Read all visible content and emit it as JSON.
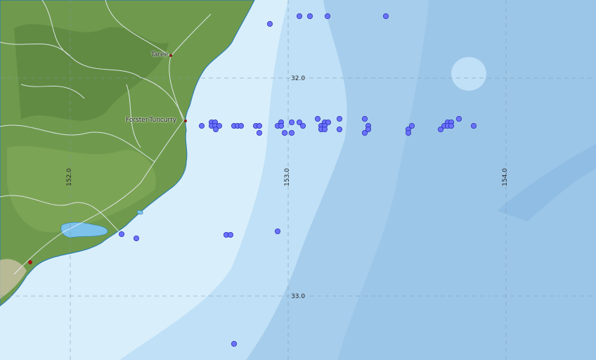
{
  "map": {
    "colors": {
      "shallow": "#d9eefb",
      "mid": "#bfe0f6",
      "deep": "#a6cdec",
      "deeper": "#8fbde3",
      "land": "#6f9a4d",
      "land_dark": "#56803a",
      "coast": "#2f7fb0",
      "road": "#e8e8ff",
      "point_fill": "#6b72ff",
      "point_stroke": "#2a2fb8",
      "town_dot": "#8b1a1a",
      "grid": "#7f97ad"
    },
    "graticule": {
      "lat_labels": [
        "32.0",
        "33.0"
      ],
      "lon_labels": [
        "152.0",
        "153.0",
        "154.0"
      ]
    },
    "towns": [
      {
        "name": "Taree"
      },
      {
        "name": "Forster-Tuncurry"
      },
      {
        "name": ""
      }
    ],
    "points_count_note": ""
  }
}
